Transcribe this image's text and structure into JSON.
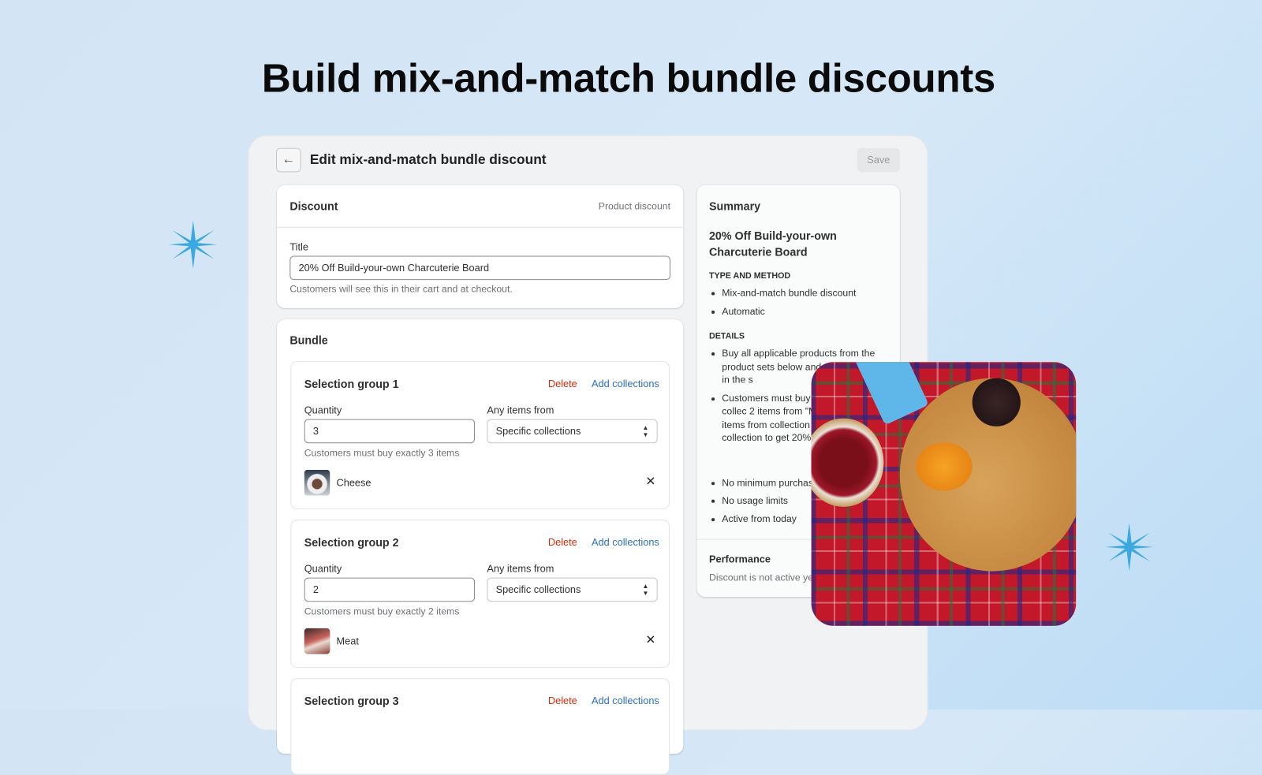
{
  "headline": "Build mix-and-match bundle discounts",
  "page": {
    "title": "Edit mix-and-match bundle discount",
    "save_label": "Save"
  },
  "discount_card": {
    "heading": "Discount",
    "type": "Product discount",
    "title_label": "Title",
    "title_value": "20% Off Build-your-own Charcuterie Board",
    "title_help": "Customers will see this in their cart and at checkout."
  },
  "bundle": {
    "heading": "Bundle",
    "groups": [
      {
        "name": "Selection group 1",
        "delete": "Delete",
        "add": "Add collections",
        "qty_label": "Quantity",
        "qty": "3",
        "from_label": "Any items from",
        "from_value": "Specific collections",
        "help": "Customers must buy exactly 3 items",
        "collection": "Cheese"
      },
      {
        "name": "Selection group 2",
        "delete": "Delete",
        "add": "Add collections",
        "qty_label": "Quantity",
        "qty": "2",
        "from_label": "Any items from",
        "from_value": "Specific collections",
        "help": "Customers must buy exactly 2 items",
        "collection": "Meat"
      },
      {
        "name": "Selection group 3",
        "delete": "Delete",
        "add": "Add collections"
      }
    ]
  },
  "summary": {
    "heading": "Summary",
    "title": "20% Off Build-your-own Charcuterie Board",
    "type_heading": "TYPE AND METHOD",
    "type_items": [
      "Mix-and-match bundle discount",
      "Automatic"
    ],
    "details_heading": "DETAILS",
    "details_items": [
      "Buy all applicable products from the product sets below and each product in the s",
      "Customers must buy from \"Cheese\" collec 2 items from \"Meat\" exactly 2 items from collection or \"Cracke collection to get 20%",
      "No minimum purchas",
      "No usage limits",
      "Active from today"
    ],
    "performance_heading": "Performance",
    "performance_text": "Discount is not active ye"
  },
  "colors": {
    "accent_blue": "#2c6ecb",
    "delete_red": "#d72c0d",
    "star": "#3ba9e0"
  }
}
